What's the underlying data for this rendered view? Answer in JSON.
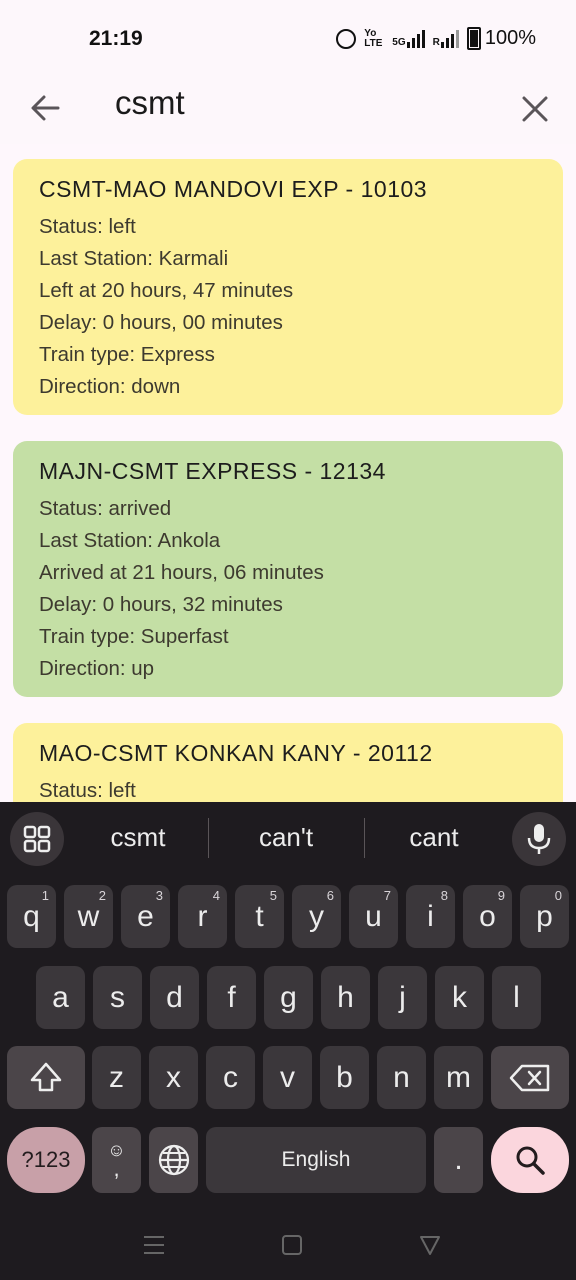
{
  "status_bar": {
    "time": "21:19",
    "volte": "Yo LTE",
    "network": "5G",
    "roaming": "R",
    "battery": "100%"
  },
  "search": {
    "query": "csmt",
    "back_icon": "arrow-left-icon",
    "clear_icon": "close-icon"
  },
  "trains": [
    {
      "title": "CSMT-MAO MANDOVI EXP - 10103",
      "status": "Status: left",
      "last_station": "Last Station: Karmali",
      "time": "Left at 20 hours, 47 minutes",
      "delay": "Delay: 0 hours, 00 minutes",
      "type": "Train type: Express",
      "direction": "Direction: down",
      "color": "#fdf19b"
    },
    {
      "title": "MAJN-CSMT EXPRESS - 12134",
      "status": "Status: arrived",
      "last_station": "Last Station: Ankola",
      "time": "Arrived at 21 hours, 06 minutes",
      "delay": "Delay: 0 hours, 32 minutes",
      "type": "Train type: Superfast",
      "direction": "Direction: up",
      "color": "#c4dfa5"
    },
    {
      "title": "MAO-CSMT KONKAN KANY - 20112",
      "status": "Status: left",
      "color": "#fdf19b"
    }
  ],
  "keyboard": {
    "suggestions": [
      "csmt",
      "can't",
      "cant"
    ],
    "row1": [
      {
        "k": "q",
        "n": "1"
      },
      {
        "k": "w",
        "n": "2"
      },
      {
        "k": "e",
        "n": "3"
      },
      {
        "k": "r",
        "n": "4"
      },
      {
        "k": "t",
        "n": "5"
      },
      {
        "k": "y",
        "n": "6"
      },
      {
        "k": "u",
        "n": "7"
      },
      {
        "k": "i",
        "n": "8"
      },
      {
        "k": "o",
        "n": "9"
      },
      {
        "k": "p",
        "n": "0"
      }
    ],
    "row2": [
      "a",
      "s",
      "d",
      "f",
      "g",
      "h",
      "j",
      "k",
      "l"
    ],
    "row3": [
      "z",
      "x",
      "c",
      "v",
      "b",
      "n",
      "m"
    ],
    "symbols_key": "?123",
    "emoji_comma": ",",
    "space_label": "English",
    "period": "."
  }
}
